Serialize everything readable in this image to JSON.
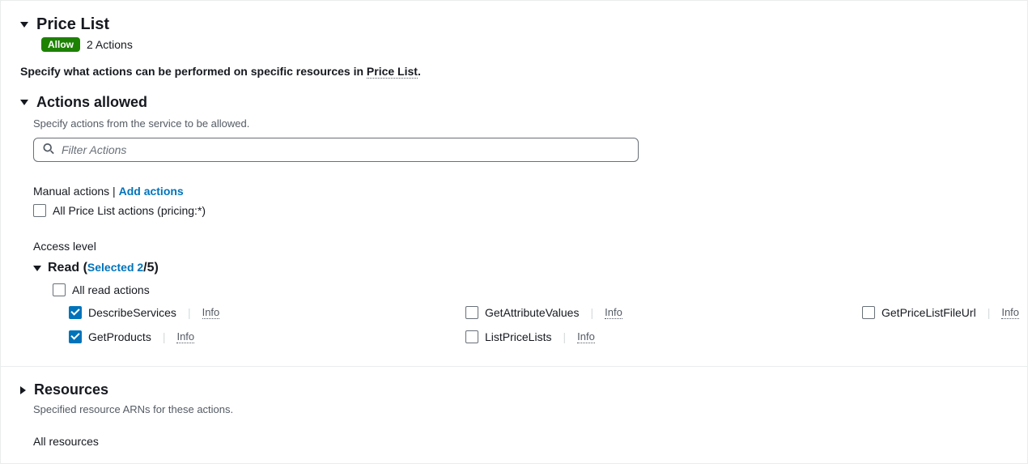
{
  "header": {
    "title": "Price List",
    "badge": "Allow",
    "actions_count": "2 Actions"
  },
  "description": {
    "prefix": "Specify what actions can be performed on specific resources in ",
    "link": "Price List",
    "suffix": "."
  },
  "actions_allowed": {
    "title": "Actions allowed",
    "desc": "Specify actions from the service to be allowed.",
    "search_placeholder": "Filter Actions"
  },
  "manual": {
    "label": "Manual actions | ",
    "add_link": "Add actions",
    "all_label": "All Price List actions (pricing:*)"
  },
  "access_level": {
    "label": "Access level"
  },
  "read": {
    "prefix": "Read (",
    "selected": "Selected 2",
    "total": "/5)",
    "all_label": "All read actions",
    "info": "Info"
  },
  "perms": {
    "describe_services": "DescribeServices",
    "get_attribute_values": "GetAttributeValues",
    "get_price_list_file_url": "GetPriceListFileUrl",
    "get_products": "GetProducts",
    "list_price_lists": "ListPriceLists"
  },
  "resources": {
    "title": "Resources",
    "desc": "Specified resource ARNs for these actions.",
    "all": "All resources"
  }
}
